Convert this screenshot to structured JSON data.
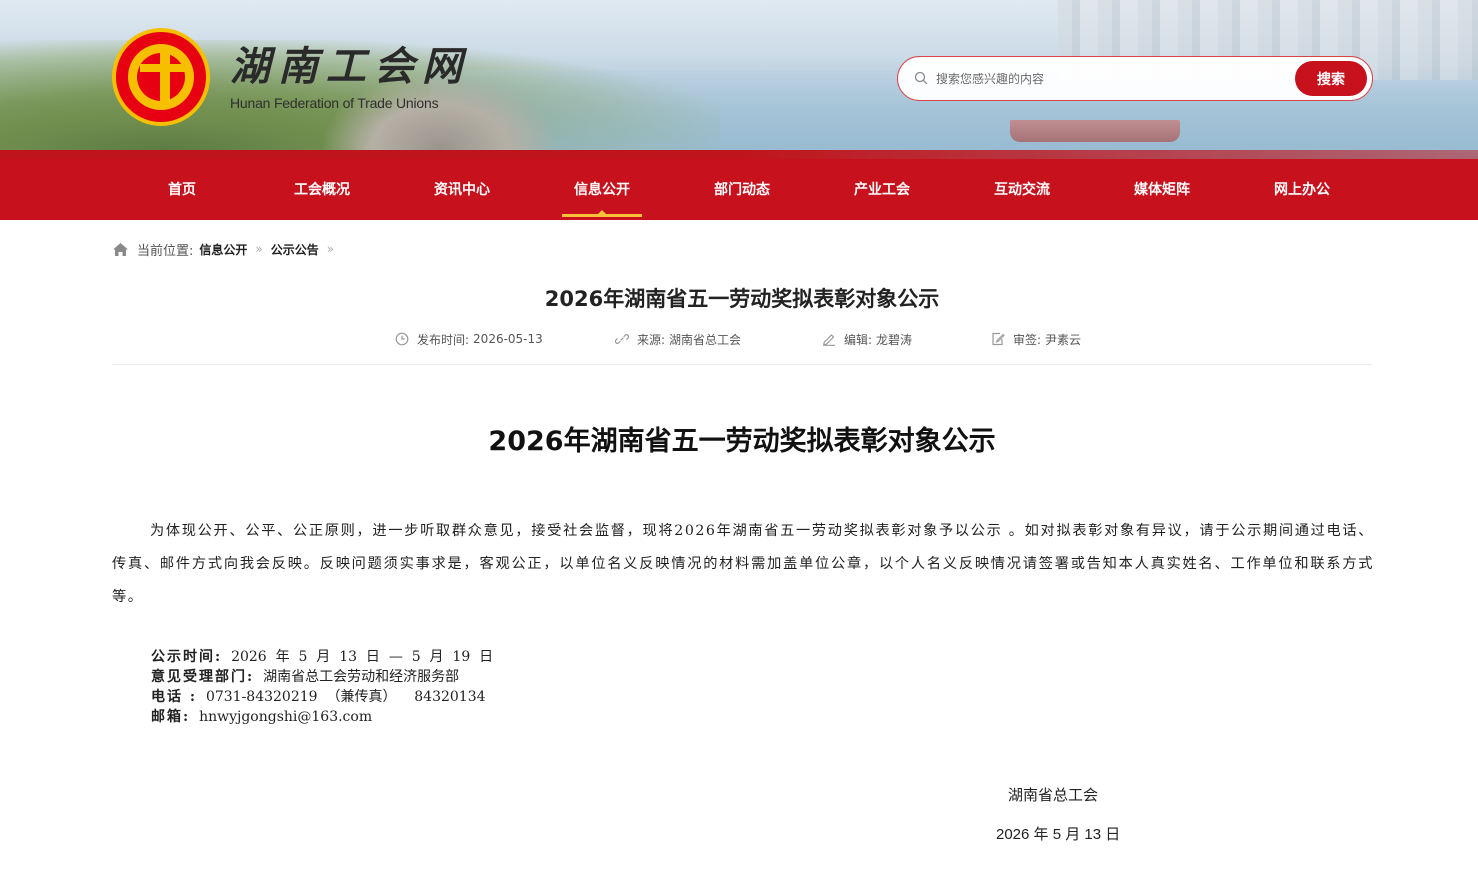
{
  "site": {
    "name_cn": "湖南工会网",
    "name_en": "Hunan Federation of Trade Unions",
    "logo_icon": "trade-union-emblem-icon",
    "brand_red": "#c7121d",
    "accent_gold": "#f6c23a"
  },
  "search": {
    "placeholder": "搜索您感兴趣的内容",
    "value": "",
    "button_label": "搜索"
  },
  "nav": {
    "items": [
      "首页",
      "工会概况",
      "资讯中心",
      "信息公开",
      "部门动态",
      "产业工会",
      "互动交流",
      "媒体矩阵",
      "网上办公"
    ],
    "active": "信息公开"
  },
  "breadcrumb": {
    "label": "当前位置:",
    "items": [
      "信息公开",
      "公示公告"
    ],
    "separator": "»"
  },
  "article": {
    "title": "2026年湖南省五一劳动奖拟表彰对象公示",
    "meta": {
      "publish_label": "发布时间:",
      "publish_value": "2026-05-13",
      "source_label": "来源:",
      "source_value": "湖南省总工会",
      "editor_label": "编辑:",
      "editor_value": "龙碧涛",
      "review_label": "审签:",
      "review_value": "尹素云"
    },
    "body_title": "2026年湖南省五一劳动奖拟表彰对象公示",
    "paragraph": "为体现公开、公平、公正原则，进一步听取群众意见，接受社会监督，现将2026年湖南省五一劳动奖拟表彰对象予以公示 。如对拟表彰对象有异议，请于公示期间通过电话、传真、邮件方式向我会反映。反映问题须实事求是，客观公正，以单位名义反映情况的材料需加盖单位公章，以个人名义反映情况请签署或告知本人真实姓名、工作单位和联系方式等。",
    "info": {
      "period_label": "公示时间:",
      "period_value": "  2026  年  5  月  13  日  —  5  月  19  日",
      "dept_label": "意见受理部门:",
      "dept_value": "  湖南省总工会劳动和经济服务部",
      "phone_label": "电话 :",
      "phone_value": "  0731-84320219  （兼传真）    84320134",
      "email_label": "邮箱:",
      "email_value": "  hnwyjgongshi@163.com"
    },
    "signature_org": "湖南省总工会",
    "signature_date": "2026 年 5 月 13 日"
  }
}
